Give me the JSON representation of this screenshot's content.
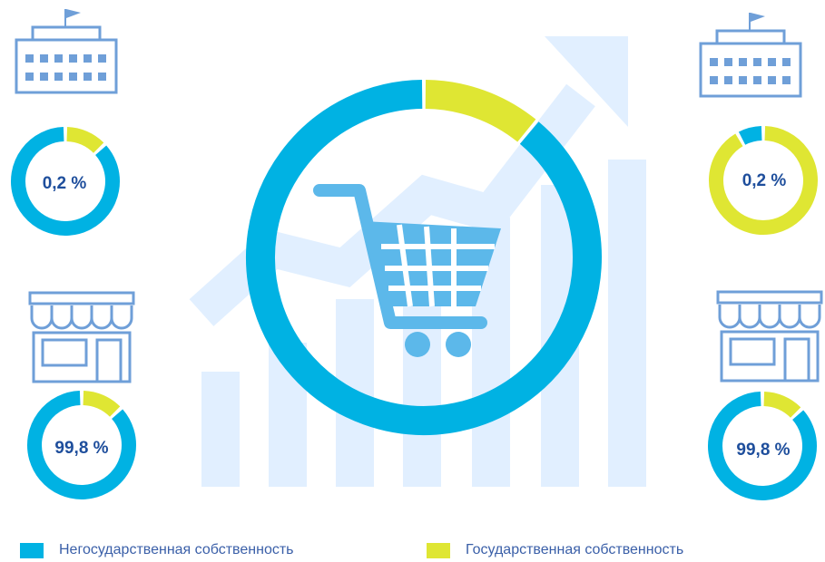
{
  "colors": {
    "non_state": "#00b2e3",
    "state": "#dfe633",
    "icon_line": "#6f9fd8",
    "background_art": "#e1efff",
    "value_text": "#1e4e9c",
    "cart": "#5cb8ea"
  },
  "icons": {
    "top_left": "government-building-icon",
    "bottom_left": "shop-storefront-icon",
    "top_right": "government-building-icon",
    "bottom_right": "shop-storefront-icon",
    "center": "shopping-cart-icon",
    "background": "rising-bars-arrow-icon"
  },
  "legend": [
    {
      "label": "Негосударственная собственность",
      "color": "#00b2e3"
    },
    {
      "label": "Государственная собственность",
      "color": "#dfe633"
    }
  ],
  "chart_data": [
    {
      "type": "pie",
      "position": "center",
      "categories": [
        "Негосударственная собственность",
        "Государственная собственность"
      ],
      "values": [
        89,
        11
      ]
    },
    {
      "type": "pie",
      "position": "top-left",
      "label": "0,2 %",
      "categories": [
        "Негосударственная собственность",
        "Государственная собственность"
      ],
      "values": [
        87,
        13
      ]
    },
    {
      "type": "pie",
      "position": "bottom-left",
      "label": "99,8 %",
      "categories": [
        "Негосударственная собственность",
        "Государственная собственность"
      ],
      "values": [
        87,
        13
      ]
    },
    {
      "type": "pie",
      "position": "top-right",
      "label": "0,2 %",
      "categories": [
        "Негосударственная собственность",
        "Государственная собственность"
      ],
      "values": [
        8,
        92
      ]
    },
    {
      "type": "pie",
      "position": "bottom-right",
      "label": "99,8 %",
      "categories": [
        "Негосударственная собственность",
        "Государственная собственность"
      ],
      "values": [
        87,
        13
      ]
    }
  ]
}
